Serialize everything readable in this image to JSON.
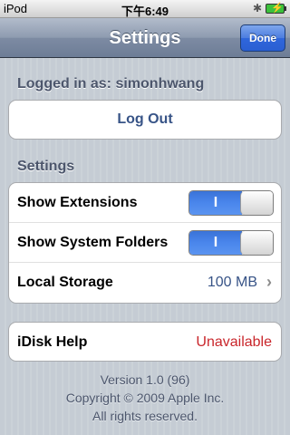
{
  "status_bar": {
    "carrier": "iPod",
    "time": "下午6:49",
    "bluetooth_icon": "bluetooth-icon",
    "battery_icon": "battery-charging-icon"
  },
  "nav": {
    "title": "Settings",
    "done_label": "Done"
  },
  "account": {
    "header": "Logged in as: simonhwang",
    "logout_label": "Log Out"
  },
  "settings": {
    "header": "Settings",
    "rows": [
      {
        "label": "Show Extensions",
        "toggle_on": true,
        "toggle_text": "I"
      },
      {
        "label": "Show System Folders",
        "toggle_on": true,
        "toggle_text": "I"
      },
      {
        "label": "Local Storage",
        "value": "100 MB"
      }
    ]
  },
  "help": {
    "label": "iDisk Help",
    "value": "Unavailable"
  },
  "footer": {
    "version": "Version 1.0 (96)",
    "copyright": "Copyright © 2009 Apple Inc.",
    "rights": "All rights reserved."
  },
  "colors": {
    "nav_blue": "#6d7d96",
    "done_blue": "#2f66db",
    "value_blue": "#385487",
    "unavailable_red": "#c9262b",
    "toggle_on_blue": "#4a86ec"
  }
}
